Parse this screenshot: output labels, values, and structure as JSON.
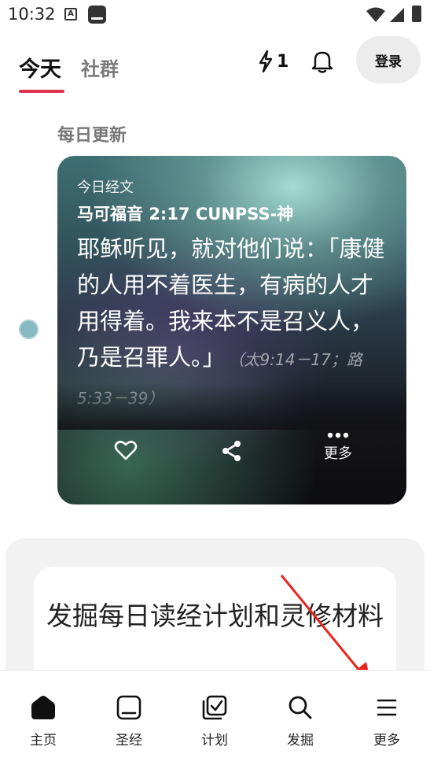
{
  "status": {
    "time": "10:32",
    "icon_a": "A"
  },
  "header": {
    "tabs": [
      {
        "label": "今天",
        "active": true
      },
      {
        "label": "社群",
        "active": false
      }
    ],
    "streak_count": "1",
    "login_label": "登录"
  },
  "section": {
    "title": "每日更新"
  },
  "verse_card": {
    "label": "今日经文",
    "reference": "马可福音 2:17 CUNPSS-神",
    "text": "耶稣听见，就对他们说：「康健的人用不着医生，有病的人才用得着。我来本不是召义人，乃是召罪人。」",
    "cross_reference": "（太9:14－17；路5:33－39）",
    "actions": {
      "more_label": "更多"
    }
  },
  "discover": {
    "text": "发掘每日读经计划和灵修材料"
  },
  "bottom_nav": [
    {
      "label": "主页",
      "icon": "home-icon"
    },
    {
      "label": "圣经",
      "icon": "bible-icon"
    },
    {
      "label": "计划",
      "icon": "plan-icon"
    },
    {
      "label": "发掘",
      "icon": "search-icon"
    },
    {
      "label": "更多",
      "icon": "menu-icon"
    }
  ],
  "colors": {
    "accent": "#e0334a",
    "timeline_dot": "#86b9c2",
    "annotation_arrow": "#e8251f"
  }
}
